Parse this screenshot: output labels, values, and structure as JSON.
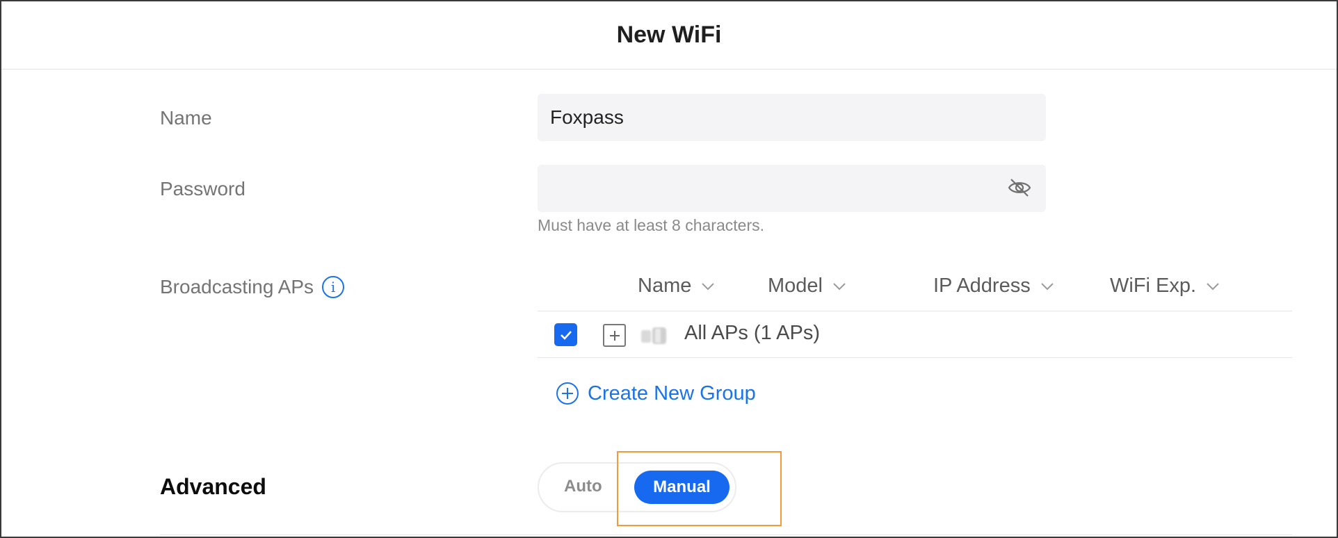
{
  "header": {
    "title": "New WiFi"
  },
  "form": {
    "name_label": "Name",
    "name_value": "Foxpass",
    "password_label": "Password",
    "password_value": "",
    "password_hint": "Must have at least 8 characters.",
    "password_toggle_icon": "eye-off-icon"
  },
  "broadcasting": {
    "label": "Broadcasting APs",
    "info_icon": "info-icon",
    "columns": [
      {
        "label": "Name",
        "icon": "chevron-down-icon"
      },
      {
        "label": "Model",
        "icon": "chevron-down-icon"
      },
      {
        "label": "IP Address",
        "icon": "chevron-down-icon"
      },
      {
        "label": "WiFi Exp.",
        "icon": "chevron-down-icon"
      }
    ],
    "rows": [
      {
        "label": "All APs (1 APs)",
        "checked": true
      }
    ],
    "create_group_label": "Create New Group"
  },
  "advanced": {
    "label": "Advanced",
    "options": [
      "Auto",
      "Manual"
    ],
    "selected": "Manual"
  },
  "colors": {
    "accent": "#1769f0",
    "link": "#1a73e8",
    "highlight": "#f39a3b"
  }
}
